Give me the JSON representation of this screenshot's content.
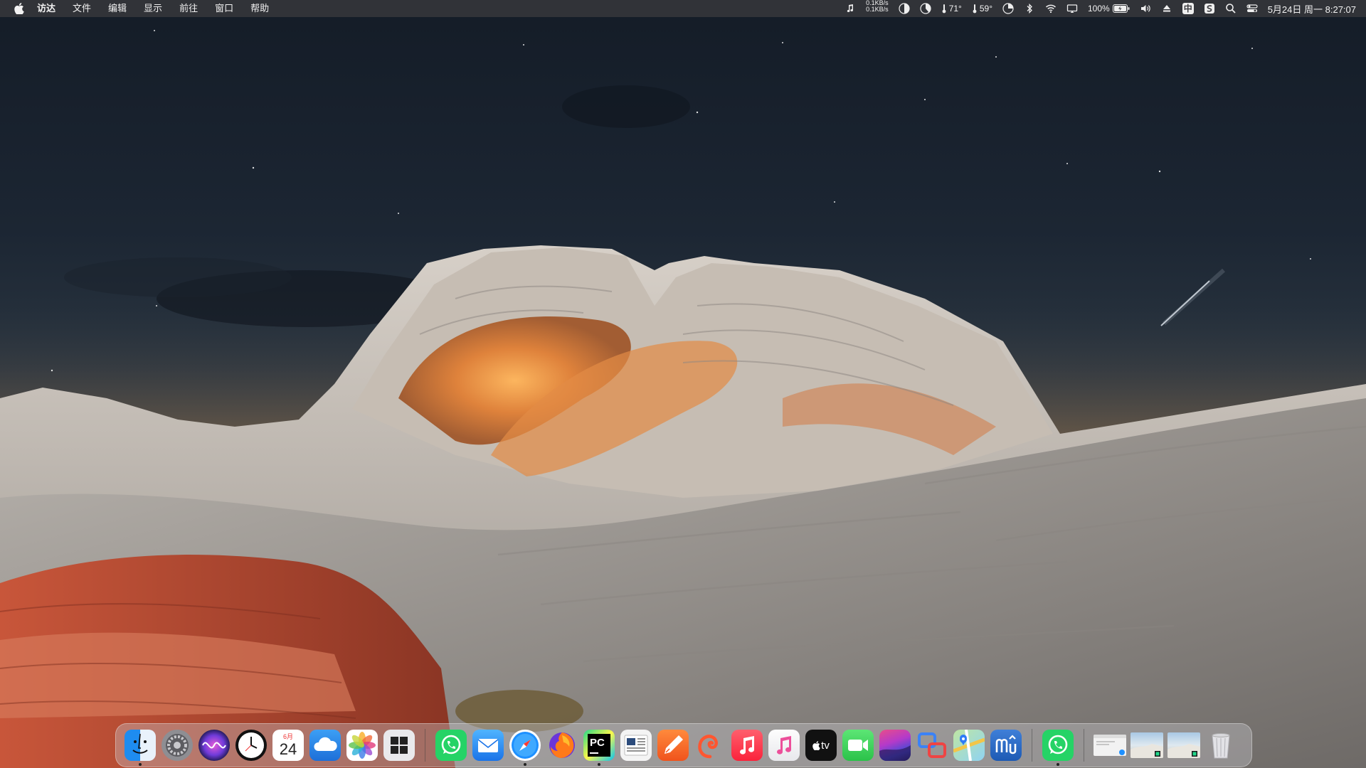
{
  "menubar": {
    "app_name": "访达",
    "menus": [
      "文件",
      "编辑",
      "显示",
      "前往",
      "窗口",
      "帮助"
    ],
    "net_up": "0.1KB/s",
    "net_down": "0.1KB/s",
    "temp1": "71°",
    "temp2": "59°",
    "battery": "100%",
    "input_method": "中",
    "clock": "5月24日 周一 8:27:07"
  },
  "dock": {
    "calendar_month": "6月",
    "calendar_day": "24",
    "pycharm_label": "PC",
    "appletv_label": "tv",
    "items": [
      {
        "name": "finder",
        "running": true
      },
      {
        "name": "system-preferences",
        "running": false
      },
      {
        "name": "siri",
        "running": false
      },
      {
        "name": "clock",
        "running": false
      },
      {
        "name": "calendar",
        "running": false
      },
      {
        "name": "weather",
        "running": false
      },
      {
        "name": "photos",
        "running": false
      },
      {
        "name": "boot-camp-windows",
        "running": false
      },
      {
        "name": "whatsapp",
        "running": false
      },
      {
        "name": "mail",
        "running": false
      },
      {
        "name": "safari",
        "running": true
      },
      {
        "name": "firefox",
        "running": false
      },
      {
        "name": "pycharm",
        "running": true
      },
      {
        "name": "news-reader",
        "running": false
      },
      {
        "name": "sketch-pen",
        "running": false
      },
      {
        "name": "swift-playgrounds",
        "running": false
      },
      {
        "name": "music",
        "running": false
      },
      {
        "name": "itunes",
        "running": false
      },
      {
        "name": "apple-tv",
        "running": false
      },
      {
        "name": "facetime",
        "running": false
      },
      {
        "name": "macos-big-sur-installer",
        "running": false
      },
      {
        "name": "screens-connect",
        "running": false
      },
      {
        "name": "maps",
        "running": false
      },
      {
        "name": "musescore",
        "running": false
      },
      {
        "name": "whatsapp-2",
        "running": true
      },
      {
        "name": "minimized-window-1",
        "running": false
      },
      {
        "name": "minimized-window-2",
        "running": false
      },
      {
        "name": "minimized-window-3",
        "running": false
      },
      {
        "name": "trash",
        "running": false
      }
    ]
  },
  "colors": {
    "menubar_bg": "#3a3a3e",
    "sky_top": "#141c27",
    "rock_orange": "#e08a3c",
    "rock_red": "#b8442a",
    "rock_white": "#c9c6c2"
  }
}
